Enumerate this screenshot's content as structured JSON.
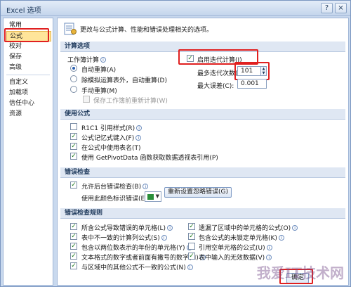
{
  "window": {
    "title": "Excel 选项",
    "help_label": "?",
    "close_label": "×"
  },
  "sidebar": {
    "items": [
      {
        "label": "常用"
      },
      {
        "label": "公式"
      },
      {
        "label": "校对"
      },
      {
        "label": "保存"
      },
      {
        "label": "高级"
      },
      {
        "label": "自定义"
      },
      {
        "label": "加载项"
      },
      {
        "label": "信任中心"
      },
      {
        "label": "资源"
      }
    ]
  },
  "header": {
    "description": "更改与公式计算、性能和错误处理相关的选项。"
  },
  "calc": {
    "section_title": "计算选项",
    "workbook_calc_label": "工作簿计算",
    "auto": "自动重算(A)",
    "auto_except_tables": "除模拟运算表外，自动重算(D)",
    "manual": "手动重算(M)",
    "recalc_before_save": "保存工作簿前重新计算(W)",
    "enable_iterative": "启用迭代计算(I)",
    "max_iterations_label": "最多迭代次数(X):",
    "max_iterations_value": "101",
    "max_change_label": "最大误差(C):",
    "max_change_value": "0.001"
  },
  "formulas": {
    "section_title": "使用公式",
    "r1c1": "R1C1 引用样式(R)",
    "autocomplete": "公式记忆式键入(F)",
    "table_names": "在公式中使用表名(T)",
    "getpivotdata": "使用 GetPivotData 函数获取数据透视表引用(P)"
  },
  "errorcheck": {
    "section_title": "错误检查",
    "background": "允许后台错误检查(B)",
    "color_label": "使用此颜色标识错误(E):",
    "reset_button": "重新设置忽略错误(G)",
    "color": "#2a8f3a"
  },
  "rules": {
    "section_title": "错误检查规则",
    "left": [
      "所含公式导致错误的单元格(L)",
      "表中不一致的计算列公式(S)",
      "包含以两位数表示的年份的单元格(Y)",
      "文本格式的数字或者前面有撇号的数字(H)",
      "与区域中的其他公式不一致的公式(N)"
    ],
    "right": [
      "遗漏了区域中的单元格的公式(O)",
      "包含公式的未锁定单元格(K)",
      "引用空单元格的公式(U)",
      "表中输入的无效数据(V)"
    ]
  },
  "footer": {
    "ok_label": "确定",
    "watermark": "我爱IT技术网"
  }
}
